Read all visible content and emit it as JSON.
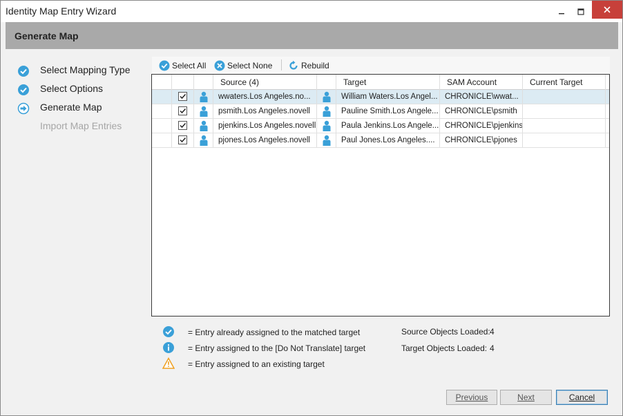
{
  "window": {
    "title": "Identity Map Entry Wizard"
  },
  "header": {
    "title": "Generate Map"
  },
  "steps": [
    {
      "label": "Select Mapping Type",
      "state": "done",
      "icon": "check-circle-icon"
    },
    {
      "label": "Select Options",
      "state": "done",
      "icon": "check-circle-icon"
    },
    {
      "label": "Generate Map",
      "state": "current",
      "icon": "arrow-right-circle-icon"
    },
    {
      "label": "Import Map Entries",
      "state": "pending",
      "icon": "none"
    }
  ],
  "toolbar": {
    "select_all": "Select All",
    "select_none": "Select None",
    "rebuild": "Rebuild"
  },
  "grid": {
    "columns": [
      "",
      "",
      "",
      "Source  (4)",
      "",
      "Target",
      "SAM Account",
      "Current Target"
    ],
    "rows": [
      {
        "checked": true,
        "source": "wwaters.Los Angeles.no...",
        "target": "William Waters.Los Angel...",
        "sam": "CHRONICLE\\wwat...",
        "current": "",
        "selected": true
      },
      {
        "checked": true,
        "source": "psmith.Los Angeles.novell",
        "target": "Pauline Smith.Los Angele...",
        "sam": "CHRONICLE\\psmith",
        "current": "",
        "selected": false
      },
      {
        "checked": true,
        "source": "pjenkins.Los Angeles.novell",
        "target": "Paula Jenkins.Los Angele...",
        "sam": "CHRONICLE\\pjenkins",
        "current": "",
        "selected": false
      },
      {
        "checked": true,
        "source": "pjones.Los Angeles.novell",
        "target": "Paul Jones.Los Angeles....",
        "sam": "CHRONICLE\\pjones",
        "current": "",
        "selected": false
      }
    ]
  },
  "legend": [
    {
      "icon": "check-circle-icon",
      "text": "= Entry already assigned to the matched target"
    },
    {
      "icon": "info-circle-icon",
      "text": "= Entry assigned to the [Do Not Translate] target"
    },
    {
      "icon": "warning-triangle-icon",
      "text": "= Entry assigned to an existing target"
    }
  ],
  "stats": {
    "source_label": "Source Objects Loaded:",
    "source_value": "4",
    "target_label": "Target Objects Loaded:",
    "target_value": "4"
  },
  "buttons": {
    "previous": "Previous",
    "next": "Next",
    "cancel": "Cancel"
  },
  "colors": {
    "accent": "#3aa0d8",
    "header_bg": "#a9a9a9",
    "selected_row": "#dcebf3",
    "close_button": "#c7403a",
    "warning": "#f0a020"
  }
}
